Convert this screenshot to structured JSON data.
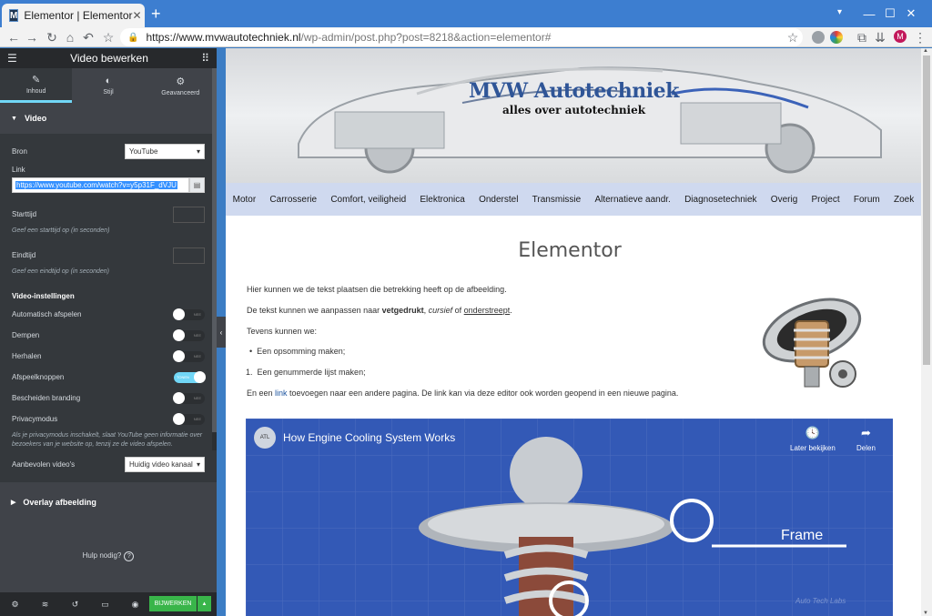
{
  "browser": {
    "tab_title": "Elementor | Elementor",
    "tab_favicon": "M",
    "url_host": "https://www.mvwautotechniek.nl",
    "url_path": "/wp-admin/post.php?post=8218&action=elementor#",
    "profile_initial": "M"
  },
  "panel": {
    "title": "Video bewerken",
    "tabs": [
      {
        "label": "Inhoud",
        "icon": "pencil-icon"
      },
      {
        "label": "Stijl",
        "icon": "contrast-icon"
      },
      {
        "label": "Geavanceerd",
        "icon": "gear-icon"
      }
    ],
    "section_title": "Video",
    "source_label": "Bron",
    "source_value": "YouTube",
    "link_label": "Link",
    "link_value": "https://www.youtube.com/watch?v=y5p31F_dVJU",
    "start_label": "Starttijd",
    "start_desc": "Geef een starttijd op (in seconden)",
    "end_label": "Eindtijd",
    "end_desc": "Geef een eindtijd op (in seconden)",
    "settings_title": "Video-instellingen",
    "toggles": [
      {
        "label": "Automatisch afspelen",
        "state": "NEE",
        "on": false
      },
      {
        "label": "Dempen",
        "state": "NEE",
        "on": false
      },
      {
        "label": "Herhalen",
        "state": "NEE",
        "on": false
      },
      {
        "label": "Afspeelknoppen",
        "state": "TONEN",
        "on": true
      },
      {
        "label": "Bescheiden branding",
        "state": "NEE",
        "on": false
      },
      {
        "label": "Privacymodus",
        "state": "NEE",
        "on": false
      }
    ],
    "privacy_desc": "Als je privacymodus inschakelt, slaat YouTube geen informatie over bezoekers van je website op, tenzij ze de video afspelen.",
    "recommended_label": "Aanbevolen video's",
    "recommended_value": "Huidig video kanaal",
    "overlay_title": "Overlay afbeelding",
    "help_text": "Hulp nodig?",
    "publish_label": "BIJWERKEN"
  },
  "site": {
    "brand": "MVW Autotechniek",
    "tagline": "alles over autotechniek",
    "nav": [
      "Motor",
      "Carrosserie",
      "Comfort, veiligheid",
      "Elektronica",
      "Onderstel",
      "Transmissie",
      "Alternatieve aandr.",
      "Diagnosetechniek",
      "Overig",
      "Project",
      "Forum",
      "Zoek"
    ],
    "heading": "Elementor",
    "p1": "Hier kunnen we de tekst plaatsen die betrekking heeft op de afbeelding.",
    "p2_a": "De tekst kunnen we aanpassen naar ",
    "p2_bold": "vetgedrukt",
    "p2_b": ", ",
    "p2_italic": "cursief",
    "p2_c": " of ",
    "p2_under": "onderstreept",
    "p2_d": ".",
    "p3": "Tevens kunnen we:",
    "bullet": "Een opsomming maken;",
    "numbered": "Een genummerde lijst maken;",
    "p4_a": "En een ",
    "p4_link": "link",
    "p4_b": " toevoegen naar een andere pagina. De link kan via deze editor ook worden geopend in een nieuwe pagina."
  },
  "video": {
    "channel_logo": "ATL",
    "title": "How Engine Cooling System Works",
    "watch_later": "Later bekijken",
    "share": "Delen",
    "frame_label": "Frame",
    "watermark": "Auto Tech Labs"
  }
}
